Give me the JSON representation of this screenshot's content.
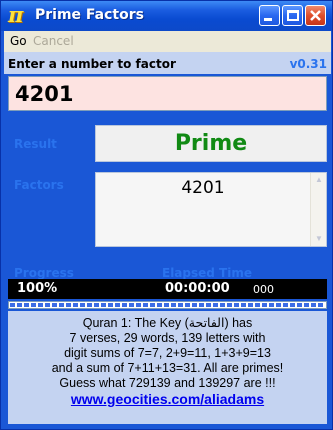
{
  "window": {
    "title": "Prime Factors",
    "icon_glyph": "π",
    "icon_name": "pi-icon"
  },
  "menu": {
    "go": "Go",
    "cancel": "Cancel"
  },
  "input": {
    "prompt": "Enter a number to factor",
    "version": "v0.31",
    "value": "4201"
  },
  "result": {
    "label": "Result",
    "value": "Prime",
    "color": "#118a14"
  },
  "factors": {
    "label": "Factors",
    "value": "4201"
  },
  "status": {
    "progress_label": "Progress",
    "elapsed_label": "Elapsed Time",
    "progress_text": "100%",
    "progress_fraction": 1.0,
    "elapsed_time": "00:00:00",
    "elapsed_ms": "000"
  },
  "about": {
    "lines": [
      "Quran 1: The Key (الفاتحة) has",
      "7 verses, 29 words, 139 letters with",
      "digit sums of 7=7, 2+9=11, 1+3+9=13",
      "and a sum of 7+11+13=31. All are primes!",
      "Guess what 729139 and 139297 are !!!"
    ],
    "link": "www.geocities.com/aliadams"
  },
  "colors": {
    "titlebar": "#0a4bd1",
    "panel": "#1a57d6",
    "input_bg": "#fde3e1",
    "label_blue": "#2a73ee"
  }
}
